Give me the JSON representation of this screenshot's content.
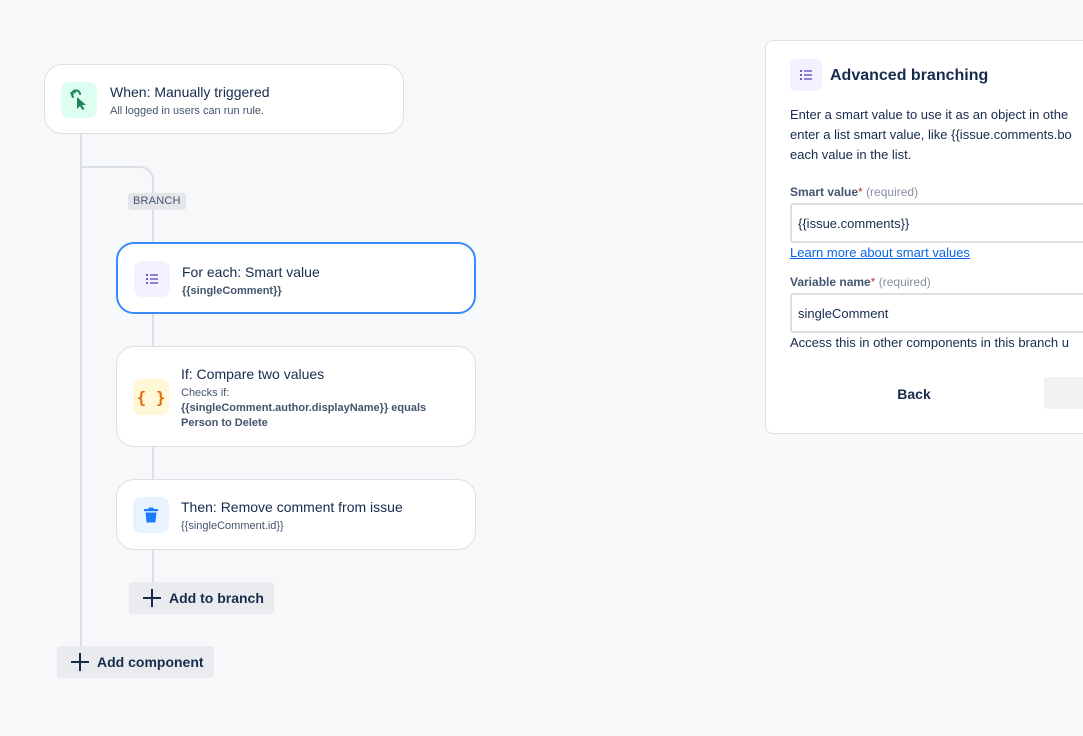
{
  "trigger": {
    "title": "When: Manually triggered",
    "subtitle": "All logged in users can run rule.",
    "icon": "cursor-click-icon"
  },
  "branch": {
    "badge": "BRANCH"
  },
  "steps": [
    {
      "title": "For each: Smart value",
      "detail": "{{singleComment}}",
      "icon": "list-icon",
      "selected": true
    },
    {
      "title": "If: Compare two values",
      "detail_prefix": "Checks if:",
      "detail_line1": "{{singleComment.author.displayName}} equals",
      "detail_line2": "Person to Delete",
      "icon": "braces-icon"
    },
    {
      "title": "Then: Remove comment from issue",
      "detail": "{{singleComment.id}}",
      "icon": "trash-icon"
    }
  ],
  "add_to_branch_label": "Add to branch",
  "add_component_label": "Add component",
  "panel": {
    "title": "Advanced branching",
    "icon": "list-icon",
    "description_lines": [
      "Enter a smart value to use it as an object in othe",
      "enter a list smart value, like {{issue.comments.bo",
      "each value in the list."
    ],
    "smart_value_label": "Smart value",
    "required_mark": "*",
    "required_hint": "(required)",
    "smart_value": "{{issue.comments}}",
    "learn_more_link": "Learn more about smart values",
    "variable_name_label": "Variable name",
    "variable_name_value": "singleComment",
    "variable_helper": "Access this in other components in this branch u",
    "back_label": "Back"
  },
  "colors": {
    "selected_border": "#388bff",
    "trigger_icon_bg": "#dcfff1",
    "trigger_icon_fg": "#1f845a",
    "list_icon_bg": "#f3f0ff",
    "list_icon_fg": "#6e5dc6",
    "condition_icon_bg": "#fff7d6",
    "condition_icon_fg": "#e56910",
    "action_icon_bg": "#e9f2ff",
    "action_icon_fg": "#1d7afc",
    "link": "#0c66e4"
  }
}
